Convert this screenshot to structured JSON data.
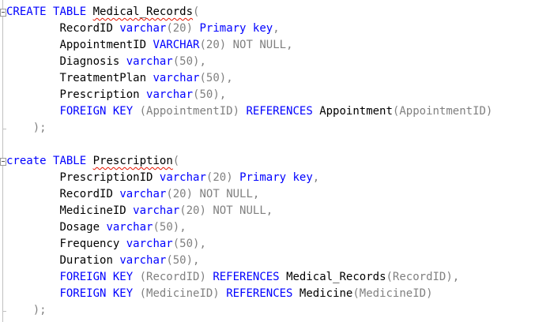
{
  "editor": {
    "colors": {
      "keyword": "#0000ff",
      "operator": "#808080",
      "text": "#000000",
      "error_squiggle": "#e51400"
    },
    "t1": {
      "kw_create": "CREATE",
      "kw_table": "TABLE",
      "name": "Medical_Records",
      "open": "(",
      "c1_name": "RecordID",
      "c1_type": "varchar",
      "c1_args": "(20)",
      "c1_pk": "Primary key",
      "c1_sep": ",",
      "c2_name": "AppointmentID",
      "c2_type": "VARCHAR",
      "c2_args": "(20)",
      "c2_null": "NOT NULL",
      "c2_sep": ",",
      "c3_name": "Diagnosis",
      "c3_type": "varchar",
      "c3_args": "(50)",
      "c3_sep": ",",
      "c4_name": "TreatmentPlan",
      "c4_type": "varchar",
      "c4_args": "(50)",
      "c4_sep": ",",
      "c5_name": "Prescription",
      "c5_type": "varchar",
      "c5_args": "(50)",
      "c5_sep": ",",
      "fk_kw": "FOREIGN KEY",
      "fk_col": "(AppointmentID)",
      "fk_ref_kw": "REFERENCES",
      "fk_ref_table": "Appointment",
      "fk_ref_col": "(AppointmentID)",
      "close": ");"
    },
    "t2": {
      "kw_create": "create",
      "kw_table": "TABLE",
      "name": "Prescription",
      "open": "(",
      "c1_name": "PrescriptionID",
      "c1_type": "varchar",
      "c1_args": "(20)",
      "c1_pk": "Primary key",
      "c1_sep": ",",
      "c2_name": "RecordID",
      "c2_type": "varchar",
      "c2_args": "(20)",
      "c2_null": "NOT NULL",
      "c2_sep": ",",
      "c3_name": "MedicineID",
      "c3_type": "varchar",
      "c3_args": "(20)",
      "c3_null": "NOT NULL",
      "c3_sep": ",",
      "c4_name": "Dosage",
      "c4_type": "varchar",
      "c4_args": "(50)",
      "c4_sep": ",",
      "c5_name": "Frequency",
      "c5_type": "varchar",
      "c5_args": "(50)",
      "c5_sep": ",",
      "c6_name": "Duration",
      "c6_type": "varchar",
      "c6_args": "(50)",
      "c6_sep": ",",
      "fk1_kw": "FOREIGN KEY",
      "fk1_col": "(RecordID)",
      "fk1_ref_kw": "REFERENCES",
      "fk1_ref_table": "Medical_Records",
      "fk1_ref_col": "(RecordID)",
      "fk1_sep": ",",
      "fk2_kw": "FOREIGN KEY",
      "fk2_col": "(MedicineID)",
      "fk2_ref_kw": "REFERENCES",
      "fk2_ref_table": "Medicine",
      "fk2_ref_col": "(MedicineID)",
      "close": ");"
    }
  }
}
